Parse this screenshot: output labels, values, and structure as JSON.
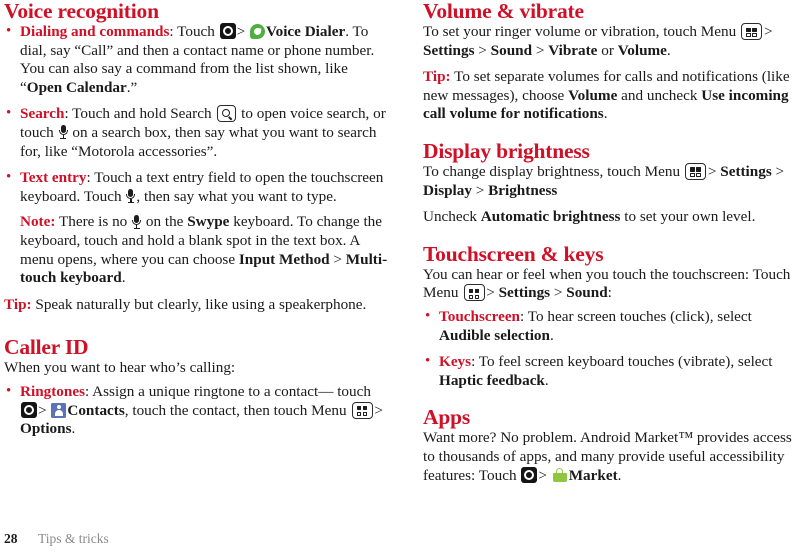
{
  "document": {
    "footer": {
      "page_number": "28",
      "chapter": "Tips & tricks"
    },
    "accent_color": "#CE1126",
    "text_color": "#1a1a1a"
  },
  "left_column": {
    "voice_recognition": {
      "heading": "Voice recognition",
      "bullets": {
        "dialing": {
          "label": "Dialing and commands",
          "t1": ": Touch",
          "t2": ">",
          "t3": "Voice Dialer",
          "t4": ". To dial, say “Call” and then a contact name or phone number. You can also say a command from the list shown, like “",
          "t5": "Open Calendar",
          "t6": ".”"
        },
        "search": {
          "label": "Search",
          "t1": ": Touch and hold Search",
          "t2": "to open voice search, or touch",
          "t3": "on a search box, then say what you want to search for, like “Motorola accessories”."
        },
        "text_entry": {
          "label": "Text entry",
          "t1": ": Touch a text entry field to open the touchscreen keyboard. Touch",
          "t2": ", then say what you want to type.",
          "note_label": "Note:",
          "n1": "There is no",
          "n2": "on the",
          "n3": "Swype",
          "n4": "keyboard. To change the keyboard, touch and hold a blank spot in the text box. A menu opens, where you can choose",
          "n5": "Input Method",
          "n6": ">",
          "n7": "Multi-touch keyboard",
          "n8": "."
        }
      },
      "tip": {
        "label": "Tip:",
        "text": "Speak naturally but clearly, like using a speakerphone."
      }
    },
    "caller_id": {
      "heading": "Caller ID",
      "intro": "When you want to hear who’s calling:",
      "bullets": {
        "ringtones": {
          "label": "Ringtones",
          "t1": ": Assign a unique ringtone to a contact— touch",
          "t2": ">",
          "t3": "Contacts",
          "t4": ", touch the contact, then touch Menu",
          "t5": ">",
          "t6": "Options",
          "t7": "."
        }
      }
    }
  },
  "right_column": {
    "volume_vibrate": {
      "heading": "Volume & vibrate",
      "para": {
        "t1": "To set your ringer volume or vibration, touch Menu",
        "t2": ">",
        "t3": "Settings",
        "t4": ">",
        "t5": "Sound",
        "t6": ">",
        "t7": "Vibrate",
        "t8": "or",
        "t9": "Volume",
        "t10": "."
      },
      "tip": {
        "label": "Tip:",
        "t1": "To set separate volumes for calls and notifications (like new messages), choose",
        "t2": "Volume",
        "t3": "and uncheck",
        "t4": "Use incoming call volume for notifications",
        "t5": "."
      }
    },
    "display_brightness": {
      "heading": "Display brightness",
      "para": {
        "t1": "To change display brightness, touch Menu",
        "t2": ">",
        "t3": "Settings",
        "t4": ">",
        "t5": "Display",
        "t6": ">",
        "t7": "Brightness"
      },
      "uncheck": {
        "t1": "Uncheck",
        "t2": "Automatic brightness",
        "t3": "to set your own level."
      }
    },
    "touchscreen_keys": {
      "heading": "Touchscreen & keys",
      "para": {
        "t1": "You can hear or feel when you touch the touchscreen: Touch Menu",
        "t2": ">",
        "t3": "Settings",
        "t4": ">",
        "t5": "Sound",
        "t6": ":"
      },
      "bullets": {
        "touchscreen": {
          "label": "Touchscreen",
          "t1": ": To hear screen touches (click), select",
          "t2": "Audible selection",
          "t3": "."
        },
        "keys": {
          "label": "Keys",
          "t1": ": To feel screen keyboard touches (vibrate), select",
          "t2": "Haptic feedback",
          "t3": "."
        }
      }
    },
    "apps": {
      "heading": "Apps",
      "para": {
        "t1": "Want more? No problem. Android Market™ provides access to thousands of apps, and many provide useful accessibility features: Touch",
        "t2": ">",
        "t3": "Market",
        "t4": "."
      }
    }
  },
  "icons": {
    "launcher": "launcher-icon",
    "voice_dialer": "voice-dialer-icon",
    "contacts": "contacts-icon",
    "market": "market-icon",
    "menu_key": "menu-key-icon",
    "search_key": "search-key-icon",
    "microphone": "microphone-icon"
  }
}
